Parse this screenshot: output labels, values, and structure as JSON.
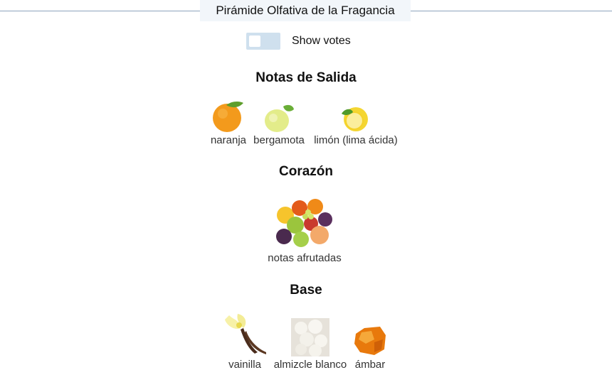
{
  "header": {
    "title": "Pirámide Olfativa de la Fragancia"
  },
  "toggle": {
    "label": "Show votes"
  },
  "sections": [
    {
      "title": "Notas de Salida",
      "notes": [
        {
          "label": "naranja",
          "icon": "orange-icon"
        },
        {
          "label": "bergamota",
          "icon": "bergamot-icon"
        },
        {
          "label": "limón (lima ácida)",
          "icon": "lemon-icon"
        }
      ]
    },
    {
      "title": "Corazón",
      "notes": [
        {
          "label": "notas afrutadas",
          "icon": "fruits-icon"
        }
      ]
    },
    {
      "title": "Base",
      "notes": [
        {
          "label": "vainilla",
          "icon": "vanilla-icon"
        },
        {
          "label": "almizcle blanco",
          "icon": "white-musk-icon"
        },
        {
          "label": "ámbar",
          "icon": "amber-icon"
        }
      ]
    }
  ]
}
